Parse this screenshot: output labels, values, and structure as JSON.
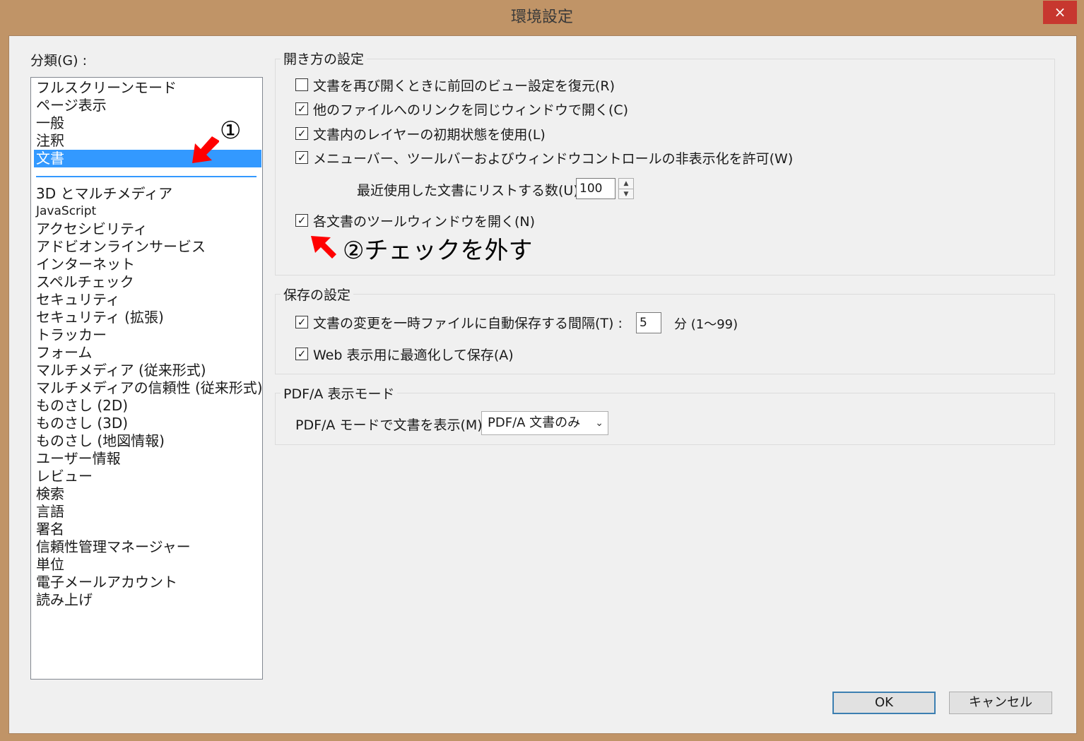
{
  "window": {
    "title": "環境設定",
    "close_glyph": "×"
  },
  "category": {
    "label": "分類(G) :",
    "items": [
      "フルスクリーンモード",
      "ページ表示",
      "一般",
      "注釈",
      "文書",
      "3D とマルチメディア",
      "JavaScript",
      "アクセシビリティ",
      "アドビオンラインサービス",
      "インターネット",
      "スペルチェック",
      "セキュリティ",
      "セキュリティ (拡張)",
      "トラッカー",
      "フォーム",
      "マルチメディア (従来形式)",
      "マルチメディアの信頼性 (従来形式)",
      "ものさし (2D)",
      "ものさし (3D)",
      "ものさし (地図情報)",
      "ユーザー情報",
      "レビュー",
      "検索",
      "言語",
      "署名",
      "信頼性管理マネージャー",
      "単位",
      "電子メールアカウント",
      "読み上げ"
    ],
    "selected": "文書"
  },
  "open_settings": {
    "title": "開き方の設定",
    "restore_view": {
      "label": "文書を再び開くときに前回のビュー設定を復元(R)",
      "checked": false
    },
    "same_window_links": {
      "label": "他のファイルへのリンクを同じウィンドウで開く(C)",
      "checked": true
    },
    "layer_initial_state": {
      "label": "文書内のレイヤーの初期状態を使用(L)",
      "checked": true
    },
    "allow_hide_bars": {
      "label": "メニューバー、ツールバーおよびウィンドウコントロールの非表示化を許可(W)",
      "checked": true
    },
    "recent_docs_label": "最近使用した文書にリストする数(U) :",
    "recent_docs_value": "100",
    "tool_window_each": {
      "label": "各文書のツールウィンドウを開く(N)",
      "checked": true
    }
  },
  "save_settings": {
    "title": "保存の設定",
    "autosave": {
      "label": "文書の変更を一時ファイルに自動保存する間隔(T) :",
      "checked": true
    },
    "autosave_value": "5",
    "autosave_unit": "分 (1～99)",
    "web_optimize": {
      "label": "Web 表示用に最適化して保存(A)",
      "checked": true
    }
  },
  "pdfa": {
    "title": "PDF/A 表示モード",
    "label": "PDF/A モードで文書を表示(M) :",
    "selected": "PDF/A 文書のみ"
  },
  "buttons": {
    "ok": "OK",
    "cancel": "キャンセル"
  },
  "annotations": {
    "step1": "①",
    "step2": "②チェックを外す"
  },
  "colors": {
    "selection": "#3399ff",
    "arrow": "#ff0000",
    "frame": "#c09467"
  }
}
